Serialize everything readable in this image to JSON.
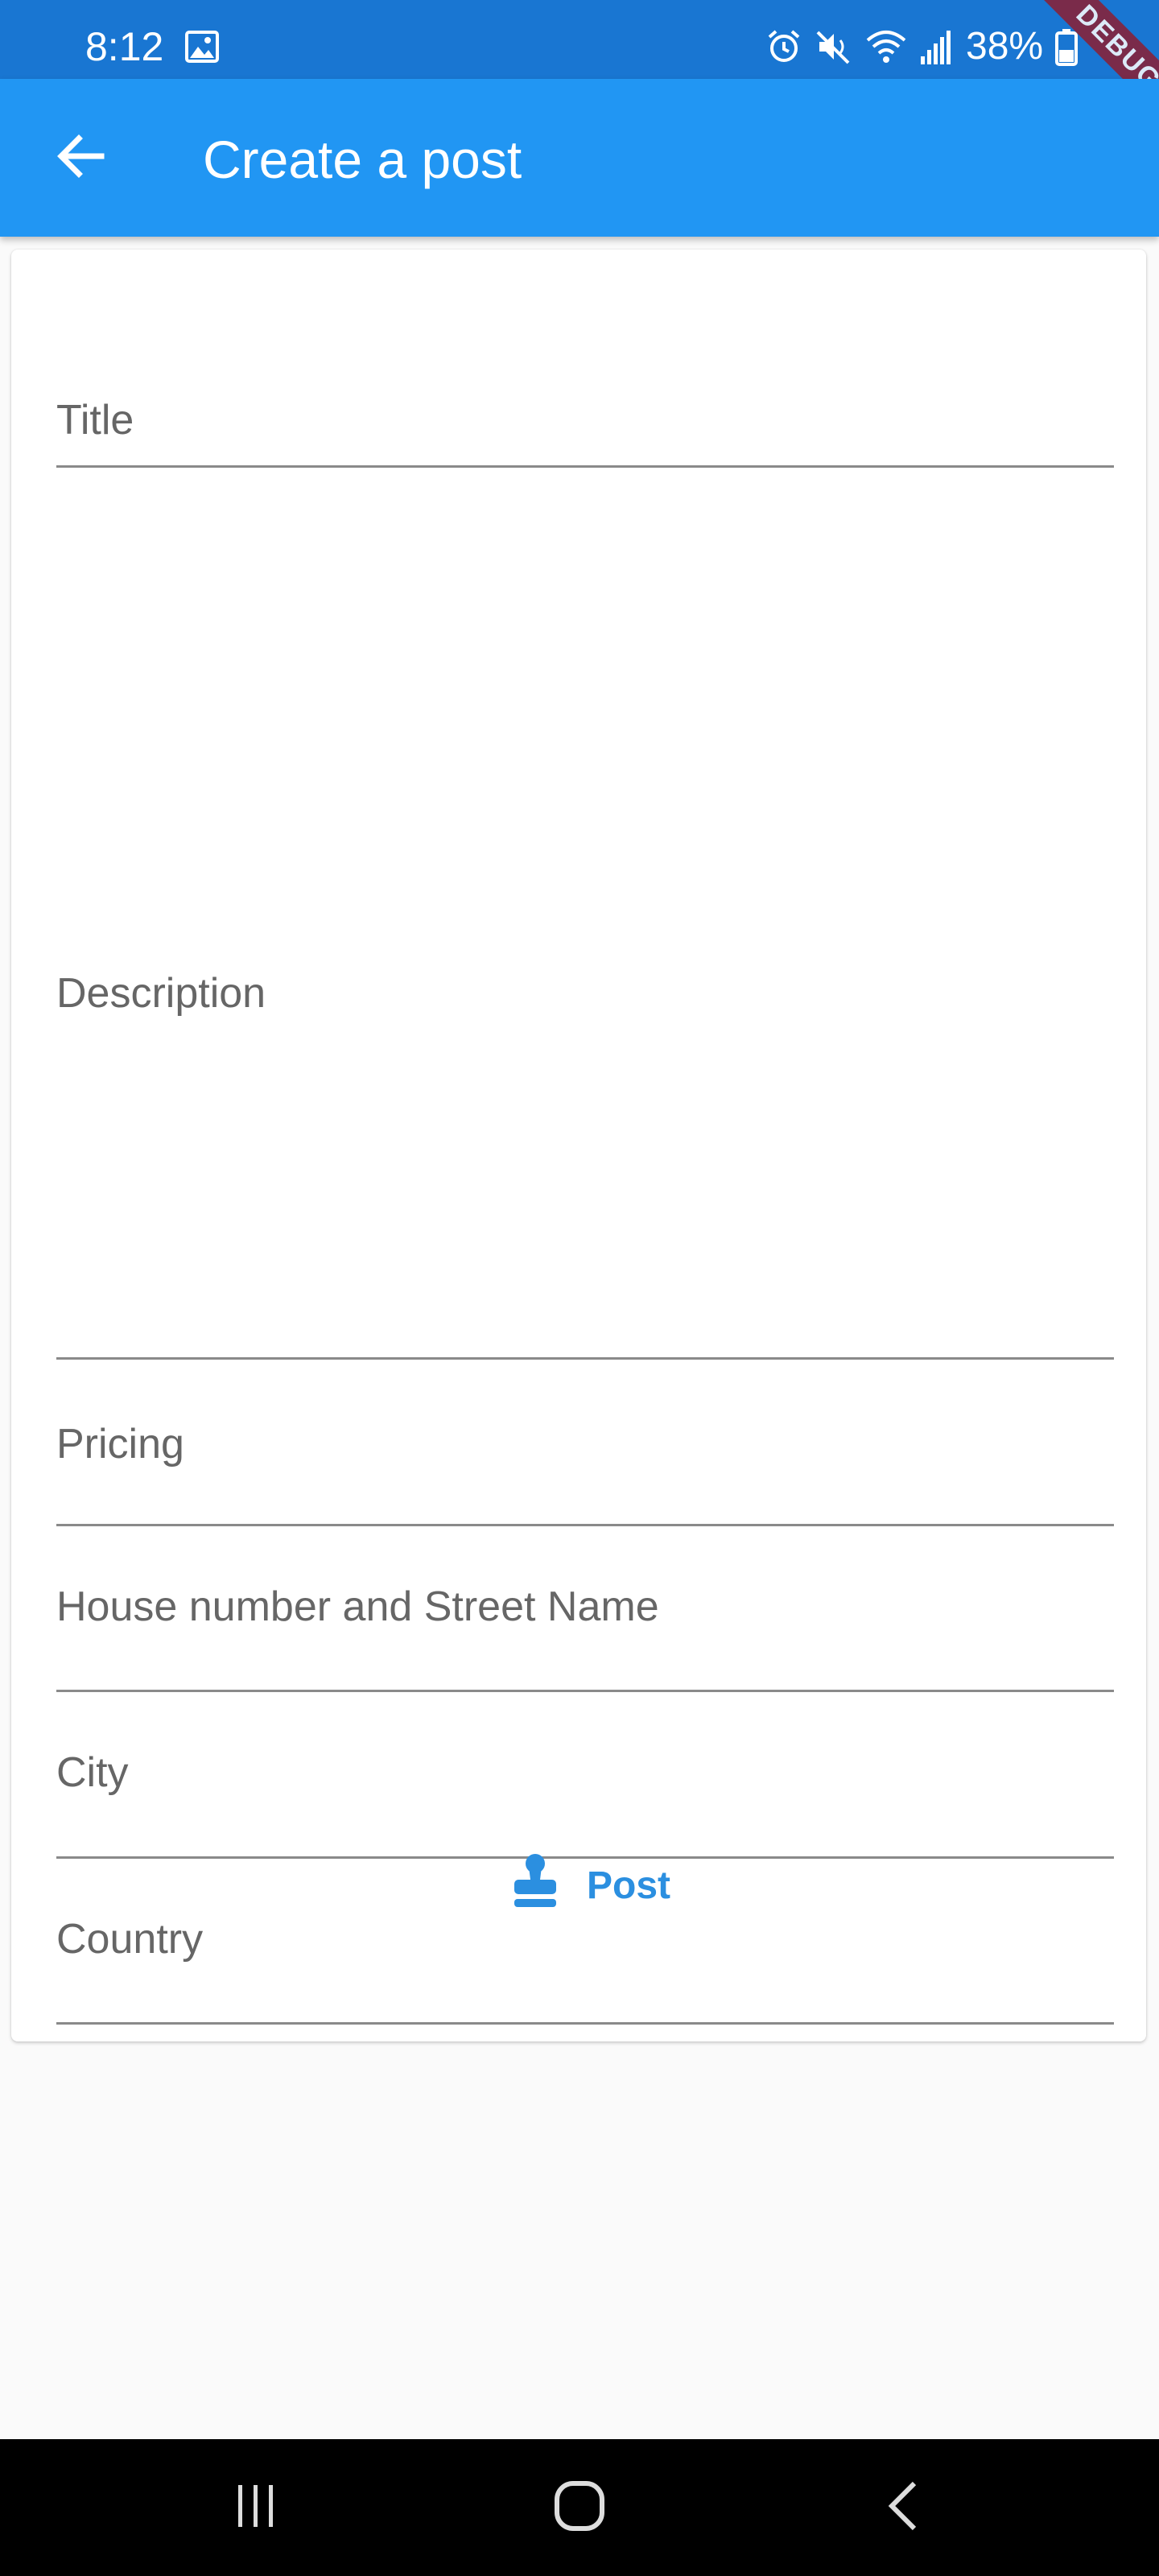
{
  "status_bar": {
    "time": "8:12",
    "battery": "38%",
    "gallery_icon": "image-icon",
    "alarm_icon": "alarm-icon",
    "mute_icon": "mute-icon",
    "wifi_icon": "wifi-icon",
    "signal_icon": "signal-icon",
    "battery_icon": "battery-icon"
  },
  "debug_banner": "DEBUG",
  "app_bar": {
    "title": "Create a post",
    "back_icon": "arrow-left-icon",
    "color": "#2196f3"
  },
  "form": {
    "fields": [
      {
        "label": "Title",
        "value": ""
      },
      {
        "label": "Description",
        "value": ""
      },
      {
        "label": "Pricing",
        "value": ""
      },
      {
        "label": "House number and Street Name",
        "value": ""
      },
      {
        "label": "City",
        "value": ""
      },
      {
        "label": "Country",
        "value": ""
      }
    ],
    "submit": {
      "label": "Post",
      "icon": "stamp-icon",
      "color": "#2b8fe0"
    }
  },
  "nav_bar": {
    "recents_icon": "recents-icon",
    "home_icon": "home-icon",
    "back_icon": "back-chevron-icon"
  }
}
